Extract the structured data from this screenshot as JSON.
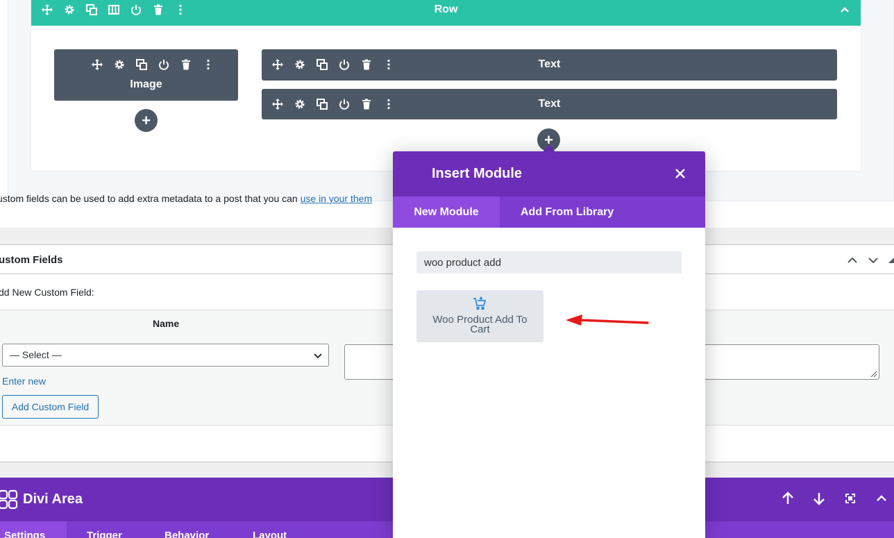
{
  "builder": {
    "row_label": "Row",
    "modules": [
      {
        "label": "Image"
      },
      {
        "label": "Text"
      },
      {
        "label": "Text"
      }
    ],
    "add_symbol": "+"
  },
  "modal": {
    "title": "Insert Module",
    "tabs": [
      {
        "label": "New Module"
      },
      {
        "label": "Add From Library"
      }
    ],
    "search_value": "woo product add",
    "results": [
      {
        "label": "Woo Product Add To Cart",
        "icon": "cart-plus-icon"
      }
    ]
  },
  "custom_fields": {
    "title": "ustom Fields",
    "add_new_label": "dd New Custom Field:",
    "name_header": "Name",
    "select_value": "— Select —",
    "enter_new": "Enter new",
    "add_button": "Add Custom Field",
    "note_text": "ustom fields can be used to add extra metadata to a post that you can ",
    "note_link": "use in your them"
  },
  "divi_area": {
    "title": "Divi Area",
    "tabs": [
      {
        "label": "Settings"
      },
      {
        "label": "Trigger"
      },
      {
        "label": "Behavior"
      },
      {
        "label": "Layout"
      }
    ]
  },
  "colors": {
    "row_header": "#2bc3a8",
    "module": "#4c5866",
    "purple": "#6c2eb9",
    "purple_tab": "#7d3cd0",
    "wp_link": "#2271b1",
    "annotation_arrow": "#e51b1b"
  }
}
